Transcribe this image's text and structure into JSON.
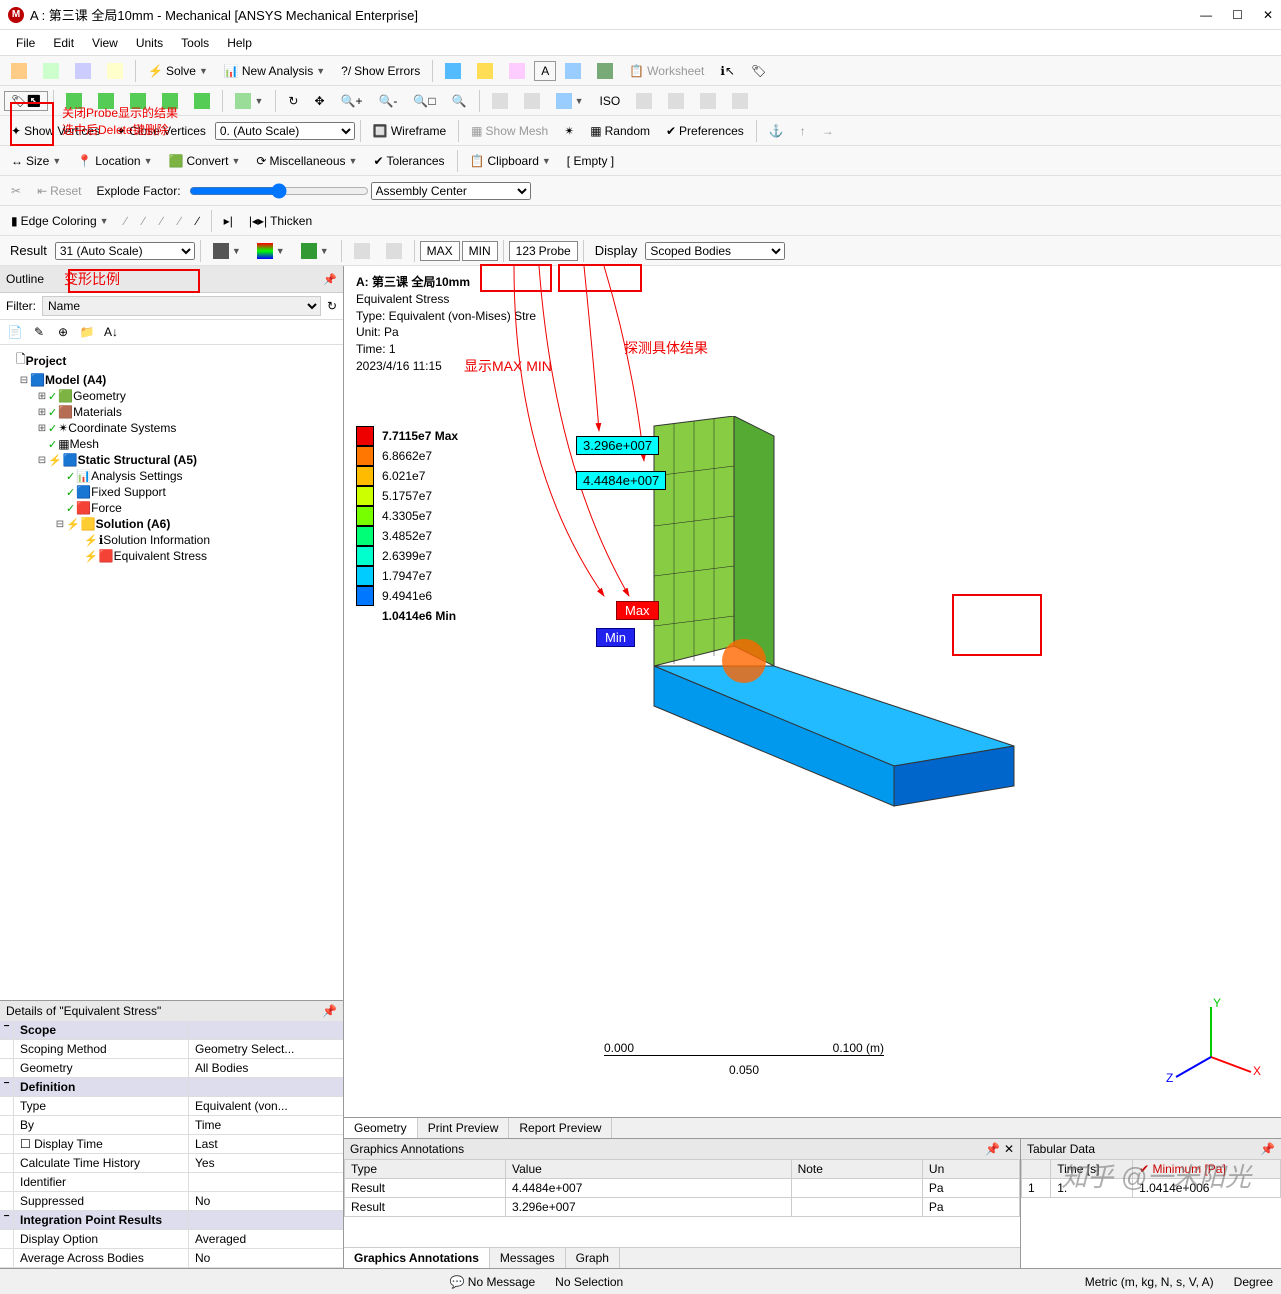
{
  "window": {
    "title": "A : 第三课 全局10mm - Mechanical [ANSYS Mechanical Enterprise]"
  },
  "menu": {
    "file": "File",
    "edit": "Edit",
    "view": "View",
    "units": "Units",
    "tools": "Tools",
    "help": "Help"
  },
  "toolbar1": {
    "solve": "Solve",
    "new_analysis": "New Analysis",
    "show_errors": "Show Errors",
    "worksheet": "Worksheet"
  },
  "annotations": {
    "close_probe1": "关闭Probe显示的结果",
    "close_probe2": "选中后Delete键删除",
    "deform_ratio": "变形比例",
    "show_maxmin": "显示MAX MIN",
    "probe_detail": "探测具体结果"
  },
  "toolbar3": {
    "show_vertices": "Show Vertices",
    "close_vertices": "Close Vertices",
    "auto_scale": "0. (Auto Scale)",
    "wireframe": "Wireframe",
    "show_mesh": "Show Mesh",
    "random": "Random",
    "preferences": "Preferences"
  },
  "toolbar4": {
    "size": "Size",
    "location": "Location",
    "convert": "Convert",
    "miscellaneous": "Miscellaneous",
    "tolerances": "Tolerances",
    "clipboard": "Clipboard",
    "empty": "[ Empty ]"
  },
  "toolbar5": {
    "reset": "Reset",
    "explode": "Explode Factor:",
    "assembly_center": "Assembly Center"
  },
  "toolbar6": {
    "edge_coloring": "Edge Coloring",
    "thicken": "Thicken"
  },
  "toolbar7": {
    "result": "Result",
    "scale": "31 (Auto Scale)",
    "max": "MAX",
    "min": "MIN",
    "probe": "Probe",
    "display": "Display",
    "scoped": "Scoped Bodies"
  },
  "outline": {
    "title": "Outline",
    "filter": "Filter:",
    "filter_val": "Name",
    "project": "Project",
    "model": "Model (A4)",
    "geometry": "Geometry",
    "materials": "Materials",
    "coord": "Coordinate Systems",
    "mesh": "Mesh",
    "static": "Static Structural (A5)",
    "analysis_settings": "Analysis Settings",
    "fixed": "Fixed Support",
    "force": "Force",
    "solution": "Solution (A6)",
    "sol_info": "Solution Information",
    "eq_stress": "Equivalent Stress"
  },
  "details": {
    "title": "Details of \"Equivalent Stress\"",
    "scope": "Scope",
    "scoping_method": "Scoping Method",
    "scoping_method_v": "Geometry Select...",
    "geometry": "Geometry",
    "geometry_v": "All Bodies",
    "definition": "Definition",
    "type": "Type",
    "type_v": "Equivalent (von...",
    "by": "By",
    "by_v": "Time",
    "display_time": "Display Time",
    "display_time_v": "Last",
    "calc_history": "Calculate Time History",
    "calc_history_v": "Yes",
    "identifier": "Identifier",
    "identifier_v": "",
    "suppressed": "Suppressed",
    "suppressed_v": "No",
    "int_point": "Integration Point Results",
    "display_option": "Display Option",
    "display_option_v": "Averaged",
    "avg_across": "Average Across Bodies",
    "avg_across_v": "No"
  },
  "canvas": {
    "title": "A: 第三课 全局10mm",
    "subtitle": "Equivalent Stress",
    "type": "Type: Equivalent (von-Mises) Stre",
    "unit": "Unit: Pa",
    "time": "Time: 1",
    "date": "2023/4/16 11:15",
    "legend": {
      "max": "7.7115e7 Max",
      "v1": "6.8662e7",
      "v2": "6.021e7",
      "v3": "5.1757e7",
      "v4": "4.3305e7",
      "v5": "3.4852e7",
      "v6": "2.6399e7",
      "v7": "1.7947e7",
      "v8": "9.4941e6",
      "min": "1.0414e6 Min"
    },
    "probe1": "3.296e+007",
    "probe2": "4.4484e+007",
    "max_label": "Max",
    "min_label": "Min",
    "scale_start": "0.000",
    "scale_mid": "0.050",
    "scale_end": "0.100 (m)",
    "tabs": {
      "geometry": "Geometry",
      "print": "Print Preview",
      "report": "Report Preview"
    }
  },
  "graphics_annotations": {
    "title": "Graphics Annotations",
    "cols": {
      "type": "Type",
      "value": "Value",
      "note": "Note",
      "unit": "Un"
    },
    "r1_type": "Result",
    "r1_value": "4.4484e+007",
    "r1_unit": "Pa",
    "r2_type": "Result",
    "r2_value": "3.296e+007",
    "r2_unit": "Pa",
    "tabs": {
      "ga": "Graphics Annotations",
      "messages": "Messages",
      "graph": "Graph"
    }
  },
  "tabular_data": {
    "title": "Tabular Data",
    "cols": {
      "time": "Time [s]",
      "min": "Minimum [Pa]"
    },
    "r1_idx": "1",
    "r1_time": "1.",
    "r1_min": "1.0414e+006"
  },
  "status": {
    "no_messages": "No Message",
    "no_selection": "No Selection",
    "units": "Metric (m, kg, N, s, V, A)",
    "degree": "Degree"
  },
  "watermark": "知乎 @一米阳光"
}
